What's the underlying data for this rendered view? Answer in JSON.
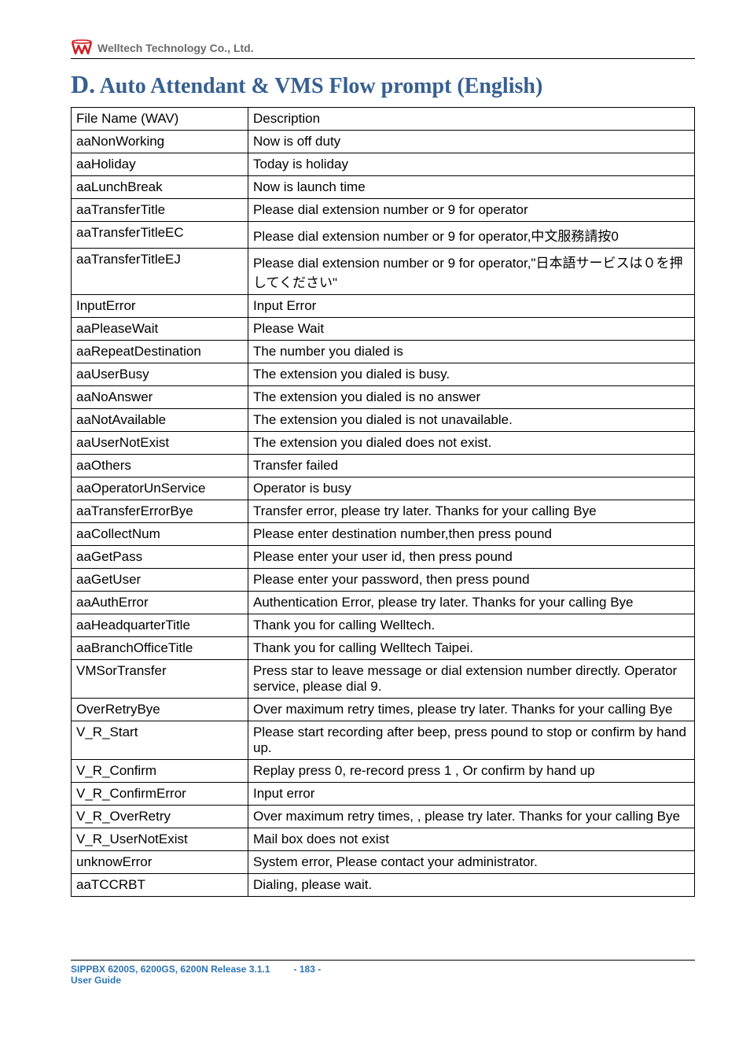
{
  "header": {
    "company": "Welltech Technology Co., Ltd."
  },
  "section": {
    "letter": "D.",
    "title": "Auto Attendant & VMS Flow prompt (English)"
  },
  "table": {
    "rows": [
      {
        "name": "File Name (WAV)",
        "desc": "Description"
      },
      {
        "name": "aaNonWorking",
        "desc": "Now is off duty"
      },
      {
        "name": "aaHoliday",
        "desc": "Today is holiday"
      },
      {
        "name": "aaLunchBreak",
        "desc": "Now is launch time"
      },
      {
        "name": "aaTransferTitle",
        "desc": "Please dial extension number or 9 for operator"
      },
      {
        "name": "aaTransferTitleEC",
        "desc": "Please dial extension number or 9 for operator,中文服務請按0"
      },
      {
        "name": "aaTransferTitleEJ",
        "desc": "Please dial extension number or 9 for operator,\"日本語サービスは０を押してください\""
      },
      {
        "name": "InputError",
        "desc": "Input Error"
      },
      {
        "name": "aaPleaseWait",
        "desc": "Please Wait"
      },
      {
        "name": "aaRepeatDestination",
        "desc": "The number you dialed is"
      },
      {
        "name": "aaUserBusy",
        "desc": "The extension you dialed is busy."
      },
      {
        "name": "aaNoAnswer",
        "desc": "The extension you dialed is no answer"
      },
      {
        "name": "aaNotAvailable",
        "desc": "The extension you dialed is not unavailable."
      },
      {
        "name": "aaUserNotExist",
        "desc": "The extension you dialed does not exist."
      },
      {
        "name": "aaOthers",
        "desc": "Transfer failed"
      },
      {
        "name": "aaOperatorUnService",
        "desc": "Operator is busy"
      },
      {
        "name": "aaTransferErrorBye",
        "desc": "Transfer error, please try later. Thanks for your calling Bye"
      },
      {
        "name": "aaCollectNum",
        "desc": "Please enter destination number,then press pound"
      },
      {
        "name": "aaGetPass",
        "desc": "Please enter your user id, then press pound"
      },
      {
        "name": "aaGetUser",
        "desc": "Please enter your password, then press pound"
      },
      {
        "name": "aaAuthError",
        "desc": "Authentication Error, please try later. Thanks for your calling Bye"
      },
      {
        "name": "aaHeadquarterTitle",
        "desc": "Thank you for calling Welltech."
      },
      {
        "name": "aaBranchOfficeTitle",
        "desc": "Thank you for calling Welltech Taipei."
      },
      {
        "name": "VMSorTransfer",
        "desc": "Press star to leave message or dial extension number directly. Operator service, please dial 9."
      },
      {
        "name": "OverRetryBye",
        "desc": "Over maximum retry times, please try later. Thanks for your calling Bye"
      },
      {
        "name": "V_R_Start",
        "desc": "Please start recording after beep, press pound to stop or confirm by hand up."
      },
      {
        "name": "V_R_Confirm",
        "desc": "Replay press 0, re-record press 1 , Or confirm by hand up"
      },
      {
        "name": "V_R_ConfirmError",
        "desc": "Input error"
      },
      {
        "name": "V_R_OverRetry",
        "desc": "Over maximum retry times, , please try later. Thanks for your calling Bye"
      },
      {
        "name": "V_R_UserNotExist",
        "desc": "Mail box does not exist"
      },
      {
        "name": "unknowError",
        "desc": "System error, Please contact your administrator."
      },
      {
        "name": "aaTCCRBT",
        "desc": "Dialing, please wait."
      }
    ]
  },
  "footer": {
    "line1": "SIPPBX 6200S, 6200GS, 6200N Release 3.1.1",
    "line2": "User Guide",
    "page": "- 183 -"
  }
}
